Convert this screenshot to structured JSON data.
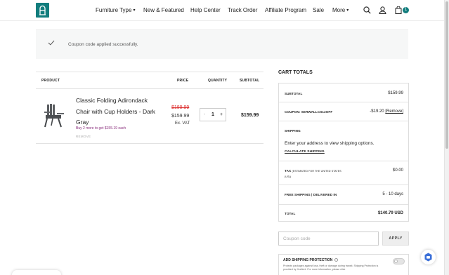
{
  "nav": {
    "items": [
      {
        "label": "Furniture Type",
        "caret": true
      },
      {
        "label": "New & Featured",
        "caret": false
      },
      {
        "label": "Help Center",
        "caret": false
      },
      {
        "label": "Track Order",
        "caret": false
      },
      {
        "label": "Affiliate Program",
        "caret": false
      },
      {
        "label": "Sale",
        "caret": false
      },
      {
        "label": "More",
        "caret": true
      }
    ],
    "caret_glyph": "▾",
    "cart_count": "1",
    "icons": [
      "search-icon",
      "account-icon",
      "cart-icon"
    ]
  },
  "notice": {
    "message": "Coupon code applied successfully."
  },
  "table": {
    "headers": {
      "product": "PRODUCT",
      "price": "PRICE",
      "quantity": "QUANTITY",
      "subtotal": "SUBTOTAL"
    },
    "item": {
      "name": "Classic Folding Adirondack Chair with Cup Holders - Dark Gray",
      "promo": "Buy 2 more to get $155.19 each",
      "remove": "REMOVE",
      "price_old": "$189.99",
      "price_new": "$159.99",
      "price_note": "Ex. VAT",
      "qty_minus": "-",
      "qty": "1",
      "qty_plus": "+",
      "subtotal": "$159.99"
    }
  },
  "totals": {
    "title": "CART TOTALS",
    "subtotal_label": "SUBTOTAL",
    "subtotal_value": "$159.99",
    "coupon_label": "COUPON: SERWALLCS12OFF",
    "coupon_value": "-$19.20",
    "coupon_remove": "[Remove]",
    "shipping_label": "SHIPPING",
    "shipping_text": "Enter your address to view shipping options.",
    "shipping_link": "CALCULATE SHIPPING",
    "tax_label": "TAX",
    "tax_note": "(ESTIMATED FOR THE UNITED STATES (US))",
    "tax_value": "$0.00",
    "freeship_label": "FREE SHIPPING | DELIVERED IN",
    "freeship_value": "5 - 10 days",
    "total_label": "TOTAL",
    "total_value": "$140.79 USD"
  },
  "coupon": {
    "placeholder": "Coupon code",
    "apply": "APPLY"
  },
  "protection": {
    "title": "ADD SHIPPING PROTECTION",
    "desc": "Protects packages against loss, theft or damage during transit. Shipping Protection is provided by Xcellent. For more information, please click",
    "enabled": false
  },
  "colors": {
    "brand": "#127d7d",
    "promo": "#8a2f7d",
    "old_price": "#dd3333"
  }
}
